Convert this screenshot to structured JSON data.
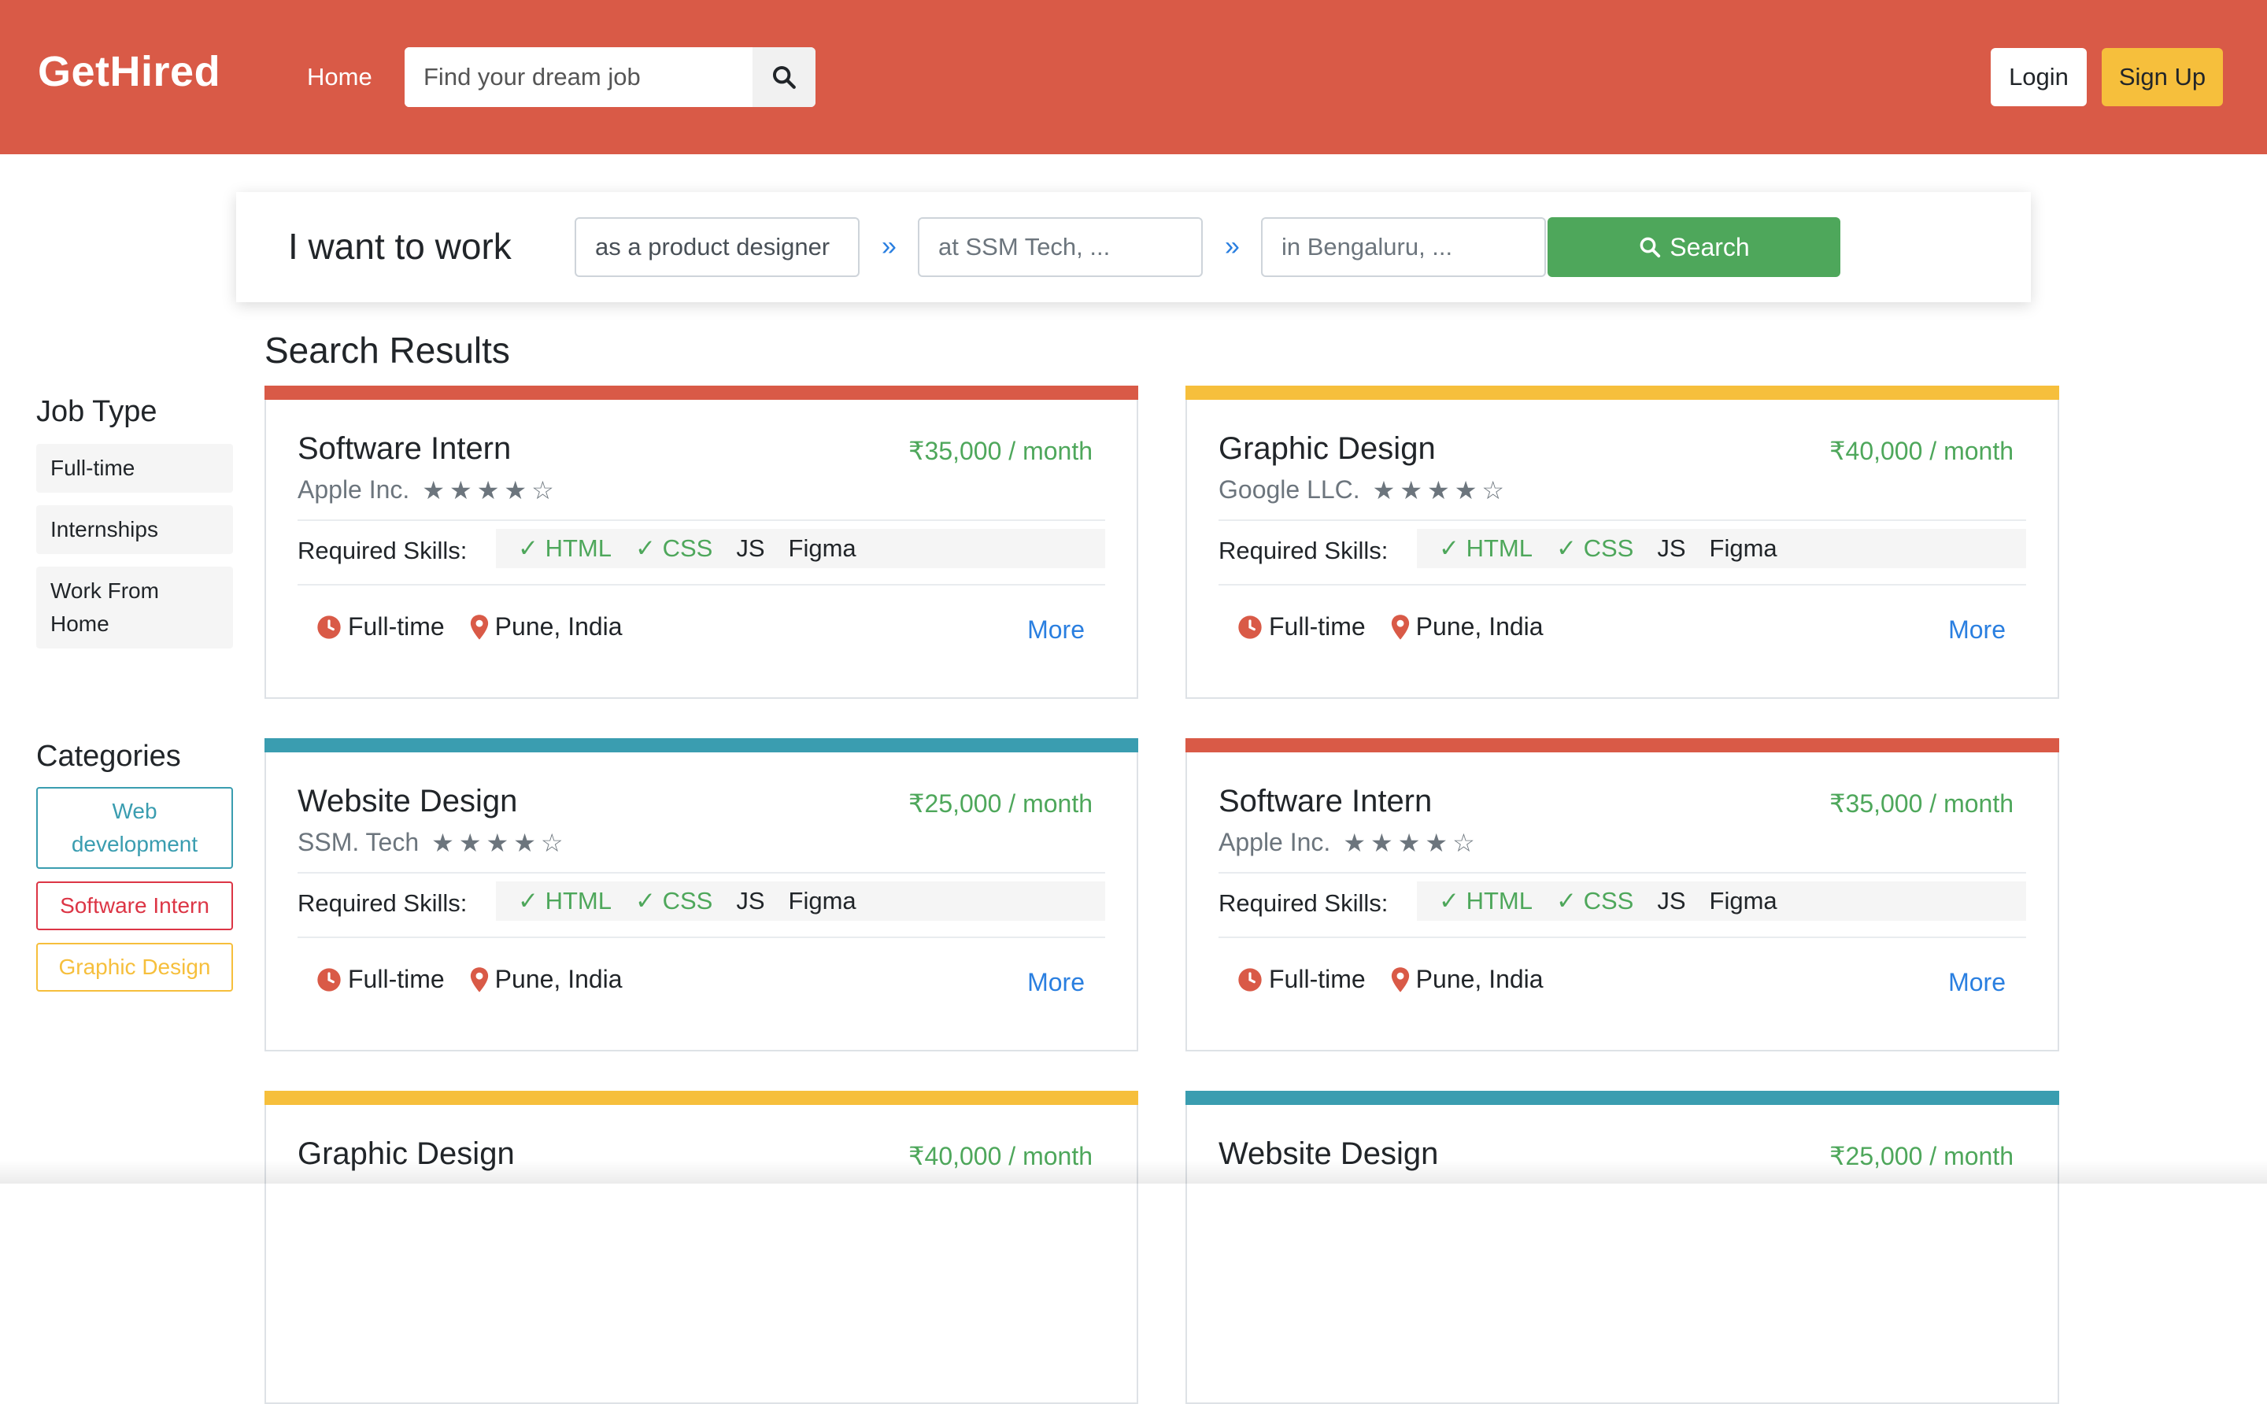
{
  "header": {
    "brand": "GetHired",
    "nav_home": "Home",
    "search_placeholder": "Find your dream job",
    "login_label": "Login",
    "signup_label": "Sign Up",
    "colors": {
      "primary": "#d95a47",
      "signup": "#f6bf3c"
    }
  },
  "search_panel": {
    "lead": "I want to work",
    "role_value": "as a product designer",
    "company_placeholder": "at SSM Tech, ...",
    "location_placeholder": "in Bengaluru, ...",
    "separator": "»",
    "search_label": "Search"
  },
  "results_title": "Search Results",
  "sidebar": {
    "job_type_title": "Job Type",
    "job_types": [
      "Full-time",
      "Internships",
      "Work From Home"
    ],
    "categories_title": "Categories",
    "categories": [
      {
        "label": "Web development",
        "color": "#3a9db0"
      },
      {
        "label": "Software Intern",
        "color": "#dc3545"
      },
      {
        "label": "Graphic Design",
        "color": "#f6bf3c"
      }
    ]
  },
  "skills_label": "Required Skills:",
  "more_label": "More",
  "jobs": [
    {
      "title": "Software Intern",
      "pay": "₹35,000 / month",
      "company": "Apple Inc.",
      "rating": 4,
      "skills_checked": [
        "HTML",
        "CSS"
      ],
      "skills_other": [
        "JS",
        "Figma"
      ],
      "type": "Full-time",
      "location": "Pune, India",
      "color": "#d95a47"
    },
    {
      "title": "Graphic Design",
      "pay": "₹40,000 / month",
      "company": "Google LLC.",
      "rating": 4,
      "skills_checked": [
        "HTML",
        "CSS"
      ],
      "skills_other": [
        "JS",
        "Figma"
      ],
      "type": "Full-time",
      "location": "Pune, India",
      "color": "#f6bf3c"
    },
    {
      "title": "Website Design",
      "pay": "₹25,000 / month",
      "company": "SSM. Tech",
      "rating": 4,
      "skills_checked": [
        "HTML",
        "CSS"
      ],
      "skills_other": [
        "JS",
        "Figma"
      ],
      "type": "Full-time",
      "location": "Pune, India",
      "color": "#3a9db0"
    },
    {
      "title": "Software Intern",
      "pay": "₹35,000 / month",
      "company": "Apple Inc.",
      "rating": 4,
      "skills_checked": [
        "HTML",
        "CSS"
      ],
      "skills_other": [
        "JS",
        "Figma"
      ],
      "type": "Full-time",
      "location": "Pune, India",
      "color": "#d95a47"
    },
    {
      "title": "Graphic Design",
      "pay": "₹40,000 / month",
      "color": "#f6bf3c"
    },
    {
      "title": "Website Design",
      "pay": "₹25,000 / month",
      "color": "#3a9db0"
    }
  ]
}
